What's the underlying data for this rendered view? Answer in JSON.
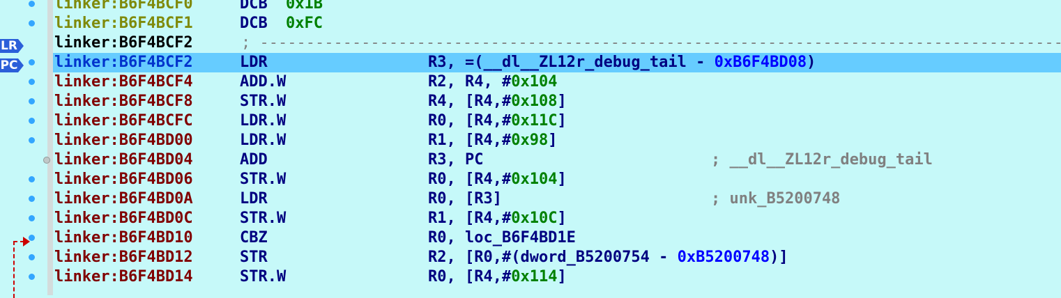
{
  "registers": {
    "lr": "LR",
    "pc": "PC"
  },
  "rows": [
    {
      "kind": "data",
      "addr": "linker:B6F4BCF0",
      "mnem": "DCB",
      "value": "0x1B"
    },
    {
      "kind": "data",
      "addr": "linker:B6F4BCF1",
      "mnem": "DCB",
      "value": "0xFC"
    },
    {
      "kind": "separator",
      "addr": "linker:B6F4BCF2",
      "text": "; ------------------------------------------------------------------------------------------"
    },
    {
      "kind": "current",
      "addr": "linker:B6F4BCF2",
      "mnem": "LDR",
      "ops": [
        {
          "t": "text",
          "v": "R3, =(__dl__ZL12r_debug_tail - "
        },
        {
          "t": "hex",
          "v": "0xB6F4BD08"
        },
        {
          "t": "text",
          "v": ")"
        }
      ]
    },
    {
      "kind": "code",
      "addr": "linker:B6F4BCF4",
      "mnem": "ADD.W",
      "ops": [
        {
          "t": "text",
          "v": "R2, R4, #"
        },
        {
          "t": "num",
          "v": "0x104"
        }
      ]
    },
    {
      "kind": "code",
      "addr": "linker:B6F4BCF8",
      "mnem": "STR.W",
      "ops": [
        {
          "t": "text",
          "v": "R4, [R4,#"
        },
        {
          "t": "num",
          "v": "0x108"
        },
        {
          "t": "text",
          "v": "]"
        }
      ]
    },
    {
      "kind": "code",
      "addr": "linker:B6F4BCFC",
      "mnem": "LDR.W",
      "ops": [
        {
          "t": "text",
          "v": "R0, [R4,#"
        },
        {
          "t": "num",
          "v": "0x11C"
        },
        {
          "t": "text",
          "v": "]"
        }
      ]
    },
    {
      "kind": "code",
      "addr": "linker:B6F4BD00",
      "mnem": "LDR.W",
      "ops": [
        {
          "t": "text",
          "v": "R1, [R4,#"
        },
        {
          "t": "num",
          "v": "0x98"
        },
        {
          "t": "text",
          "v": "]"
        }
      ]
    },
    {
      "kind": "code",
      "addr": "linker:B6F4BD04",
      "mnem": "ADD",
      "ops": [
        {
          "t": "text",
          "v": "R3, PC"
        }
      ],
      "comment": "; __dl__ZL12r_debug_tail"
    },
    {
      "kind": "code",
      "addr": "linker:B6F4BD06",
      "mnem": "STR.W",
      "ops": [
        {
          "t": "text",
          "v": "R0, [R4,#"
        },
        {
          "t": "num",
          "v": "0x104"
        },
        {
          "t": "text",
          "v": "]"
        }
      ]
    },
    {
      "kind": "code",
      "addr": "linker:B6F4BD0A",
      "mnem": "LDR",
      "ops": [
        {
          "t": "text",
          "v": "R0, [R3]"
        }
      ],
      "comment": "; unk_B5200748"
    },
    {
      "kind": "code",
      "addr": "linker:B6F4BD0C",
      "mnem": "STR.W",
      "ops": [
        {
          "t": "text",
          "v": "R1, [R4,#"
        },
        {
          "t": "num",
          "v": "0x10C"
        },
        {
          "t": "text",
          "v": "]"
        }
      ]
    },
    {
      "kind": "code",
      "addr": "linker:B6F4BD10",
      "mnem": "CBZ",
      "ops": [
        {
          "t": "text",
          "v": "R0, loc_B6F4BD1E"
        }
      ]
    },
    {
      "kind": "code",
      "addr": "linker:B6F4BD12",
      "mnem": "STR",
      "ops": [
        {
          "t": "text",
          "v": "R2, [R0,#(dword_B5200754 - "
        },
        {
          "t": "hex",
          "v": "0xB5200748"
        },
        {
          "t": "text",
          "v": ")]"
        }
      ]
    },
    {
      "kind": "code",
      "addr": "linker:B6F4BD14",
      "mnem": "STR.W",
      "ops": [
        {
          "t": "text",
          "v": "R0, [R4,#"
        },
        {
          "t": "num",
          "v": "0x114"
        },
        {
          "t": "text",
          "v": "]"
        }
      ]
    }
  ]
}
